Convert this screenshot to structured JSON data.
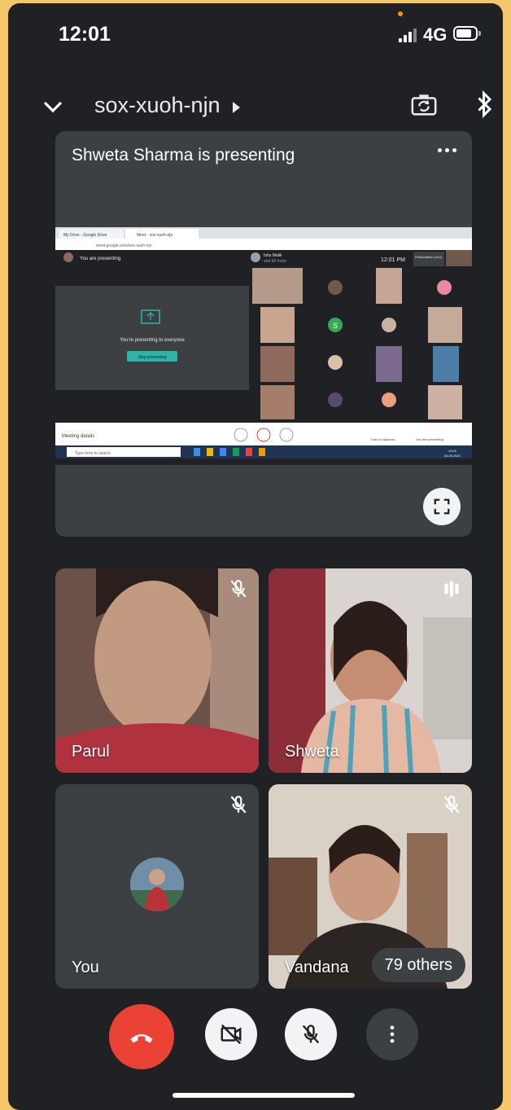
{
  "status_bar": {
    "time": "12:01",
    "network": "4G",
    "signal_icon": "signal-icon",
    "battery_icon": "battery-icon"
  },
  "header": {
    "meeting_code": "sox-xuoh-njn",
    "collapse_icon": "chevron-down-icon",
    "camera_switch_icon": "camera-switch-icon",
    "bluetooth_icon": "bluetooth-icon"
  },
  "presentation": {
    "title": "Shweta Sharma is presenting",
    "more_icon": "more-vert-icon",
    "fullscreen_icon": "fullscreen-icon",
    "shared_screen": {
      "browser_tabs": [
        "My Drive - Google Drive",
        "Meet - sox-xuoh-njn"
      ],
      "url": "meet.google.com/sox-xuoh-njn",
      "you_are_presenting": "You are presenting",
      "presenting_to_everyone": "You're presenting to everyone",
      "stop_presenting": "Stop presenting",
      "participant_name": "Ishu Malik",
      "participant_more": "and 66 more",
      "meeting_time": "12:01 PM",
      "presentation_badge": "Presentation (You)",
      "meeting_details": "Meeting details",
      "turn_on_captions": "Turn on captions",
      "you_are_presenting_footer": "You are presenting",
      "taskbar_search": "Type here to search",
      "taskbar_time": "12:01",
      "taskbar_date": "24-05-2021"
    }
  },
  "participants": [
    {
      "name": "Parul",
      "status_icon": "mic-off-icon"
    },
    {
      "name": "Shweta",
      "status_icon": "audio-levels-icon"
    },
    {
      "name": "You",
      "status_icon": "mic-off-icon"
    },
    {
      "name": "Vandana",
      "status_icon": "mic-off-icon"
    }
  ],
  "others_count_label": "79 others",
  "controls": {
    "end_call_icon": "end-call-icon",
    "camera_icon": "camera-off-icon",
    "mic_icon": "mic-off-icon",
    "more_icon": "more-vert-icon"
  },
  "colors": {
    "background": "#202124",
    "tile": "#3c4043",
    "end_call": "#ea4335",
    "accent_teal": "#1a73e8"
  }
}
